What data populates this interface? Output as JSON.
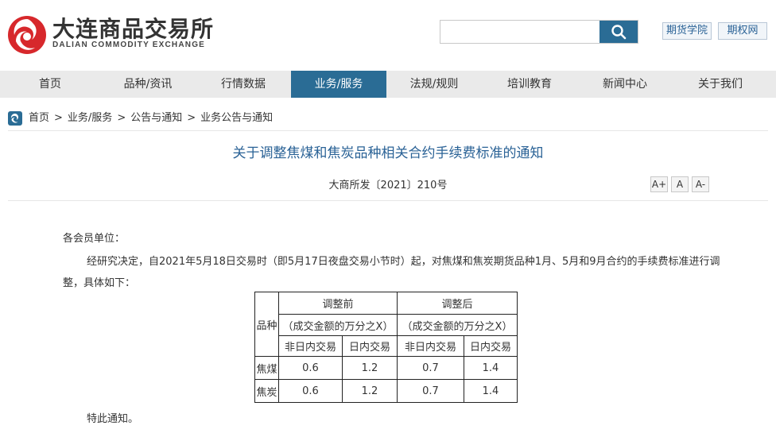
{
  "header": {
    "logo_cn": "大连商品交易所",
    "logo_en": "DALIAN COMMODITY EXCHANGE",
    "search_placeholder": "",
    "links": [
      "期货学院",
      "期权网"
    ]
  },
  "nav": {
    "items": [
      "首页",
      "品种/资讯",
      "行情数据",
      "业务/服务",
      "法规/规则",
      "培训教育",
      "新闻中心",
      "关于我们"
    ],
    "active": "业务/服务"
  },
  "breadcrumb": {
    "items": [
      "首页",
      "业务/服务",
      "公告与通知",
      "业务公告与通知"
    ],
    "separator": ">"
  },
  "article": {
    "title": "关于调整焦煤和焦炭品种相关合约手续费标准的通知",
    "doc_number": "大商所发〔2021〕210号",
    "font_buttons": [
      "A+",
      "A",
      "A-"
    ],
    "salutation": "各会员单位：",
    "paragraph": "经研究决定，自2021年5月18日交易时（即5月17日夜盘交易小节时）起，对焦煤和焦炭期货品种1月、5月和9月合约的手续费标准进行调整，具体如下：",
    "closing": "特此通知。"
  },
  "table": {
    "col_product": "品种",
    "group_before": "调整前",
    "group_after": "调整后",
    "unit_before": "（成交金额的万分之X）",
    "unit_after": "（成交金额的万分之X）",
    "sub_non_intraday": "非日内交易",
    "sub_intraday": "日内交易",
    "rows": [
      {
        "product": "焦煤",
        "before_non": "0.6",
        "before_intra": "1.2",
        "after_non": "0.7",
        "after_intra": "1.4"
      },
      {
        "product": "焦炭",
        "before_non": "0.6",
        "before_intra": "1.2",
        "after_non": "0.7",
        "after_intra": "1.4"
      }
    ]
  },
  "colors": {
    "brand_blue": "#2a6c95",
    "title_blue": "#2a6296",
    "logo_red": "#d7282c"
  }
}
